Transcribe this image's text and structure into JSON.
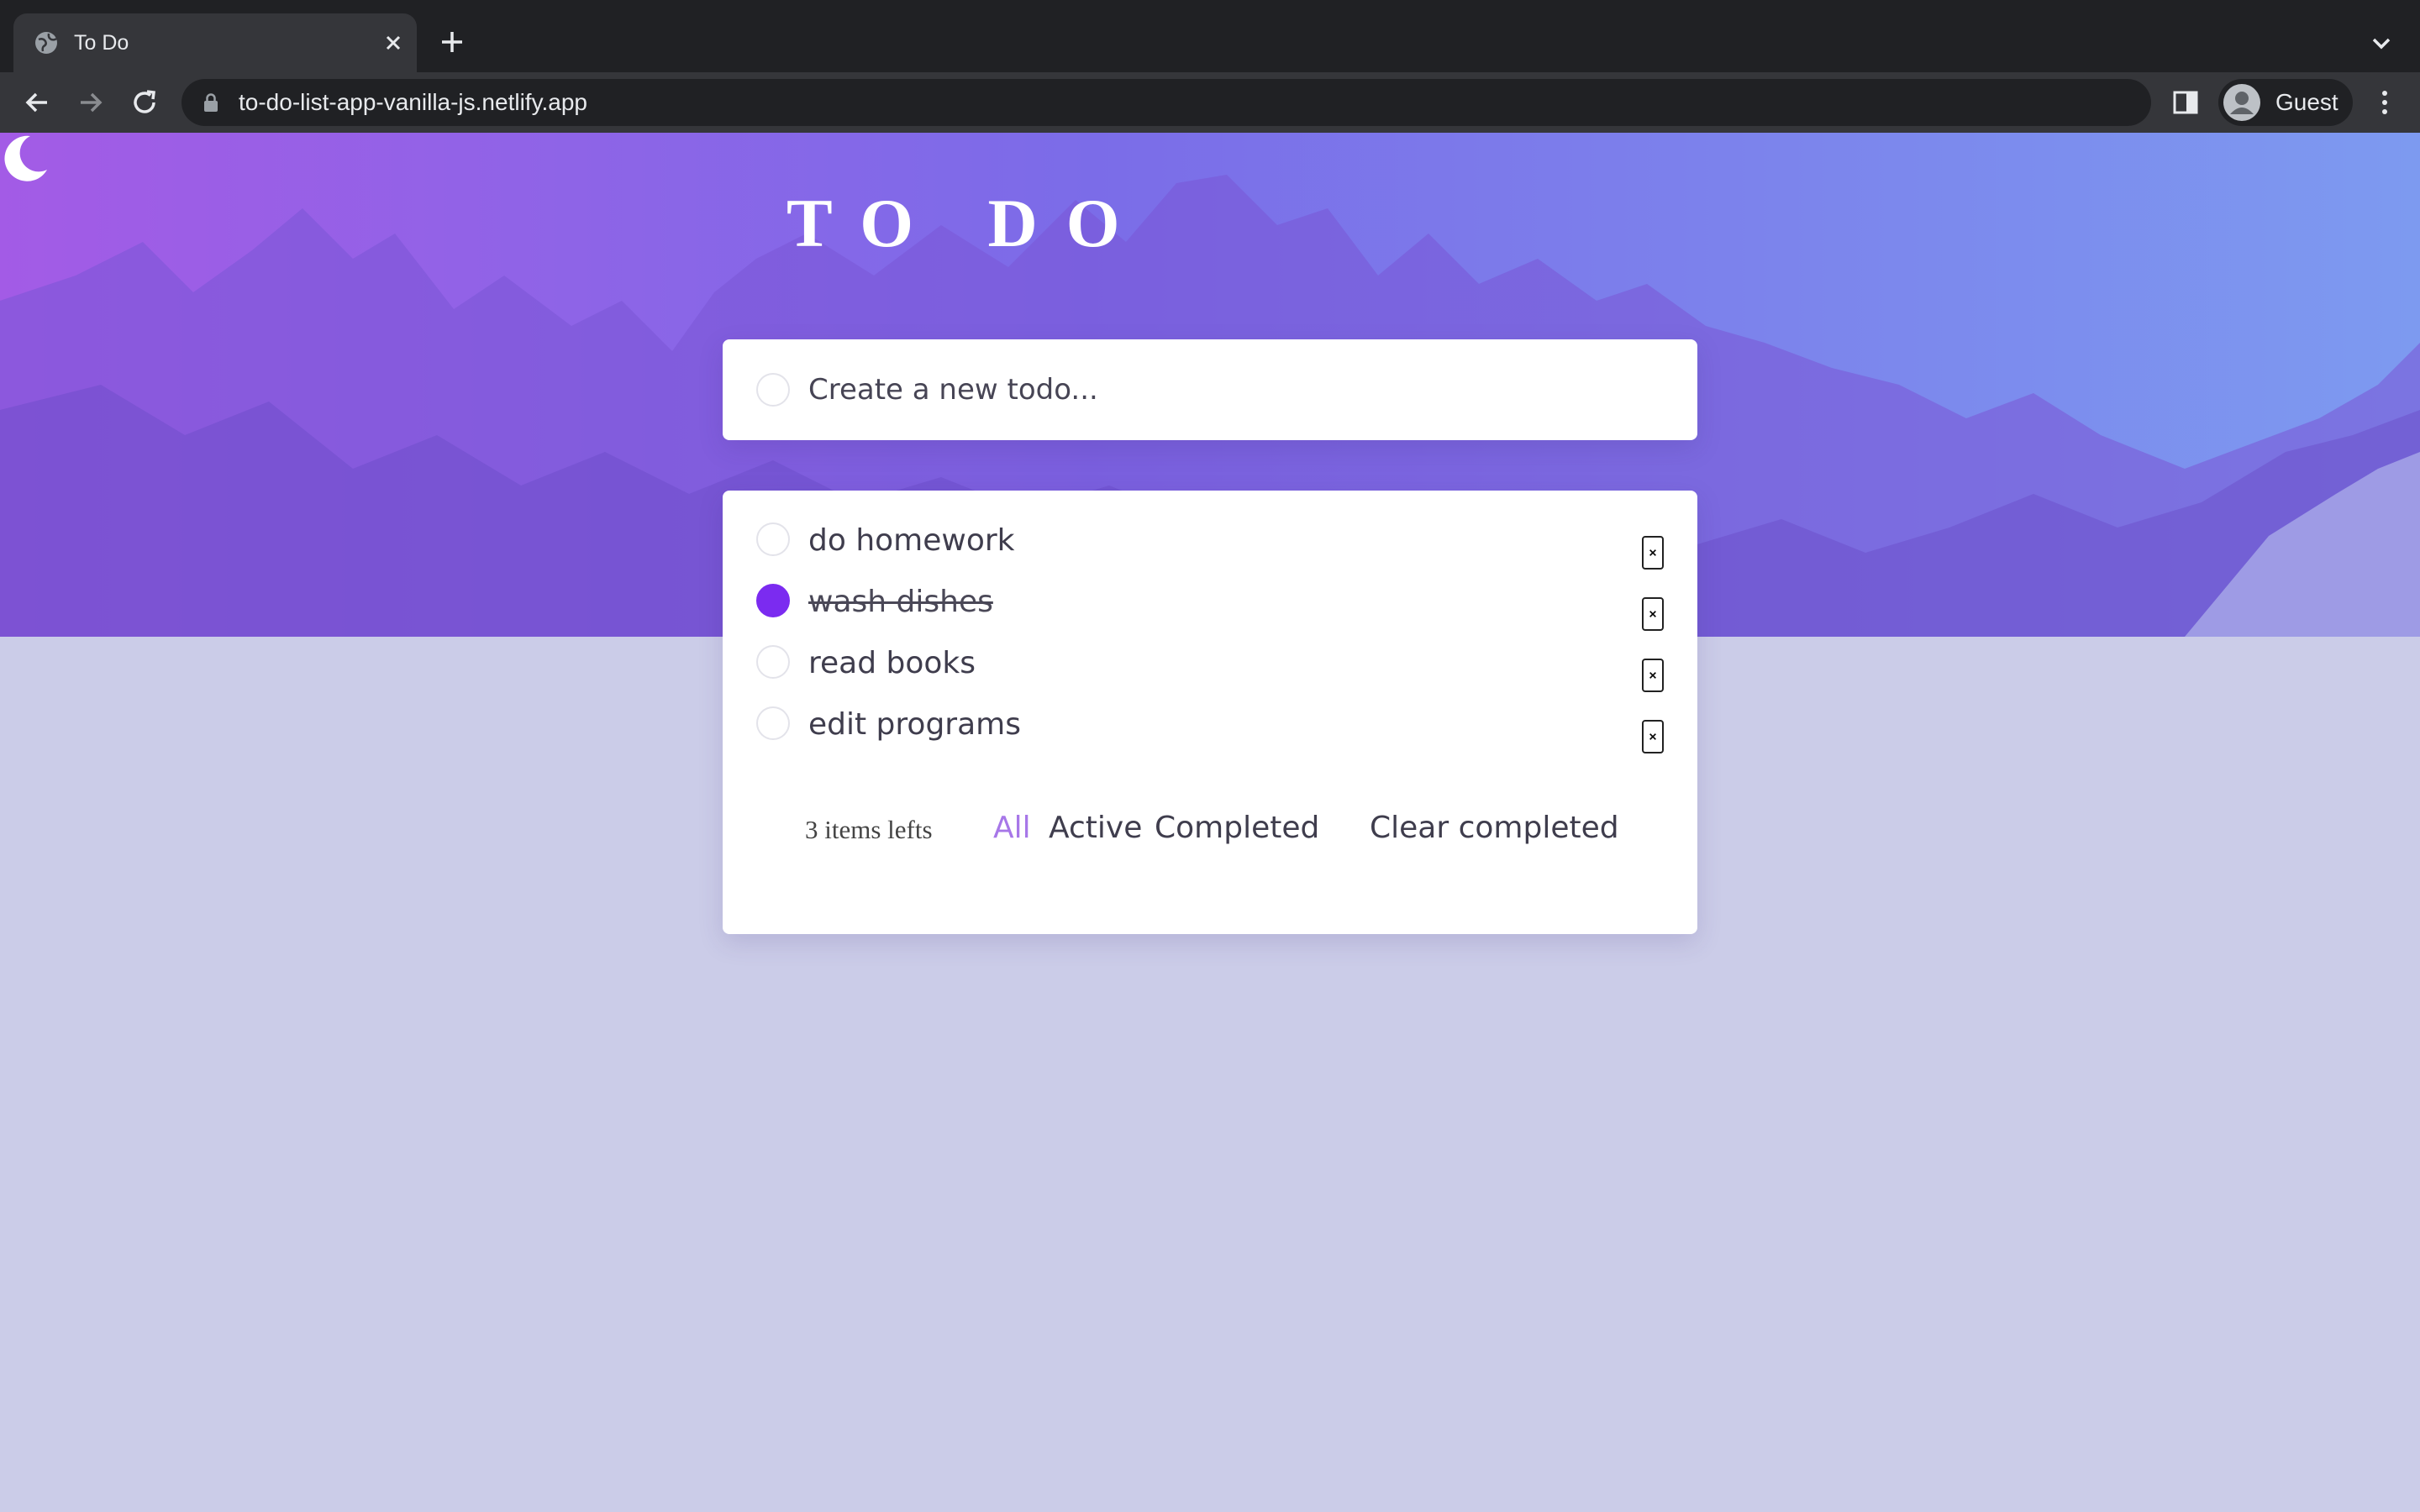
{
  "browser": {
    "tab_title": "To Do",
    "url": "to-do-list-app-vanilla-js.netlify.app",
    "profile": "Guest",
    "icons": [
      "globe-icon",
      "close-icon",
      "plus-icon",
      "chevron-down-icon",
      "back-arrow-icon",
      "forward-arrow-icon",
      "reload-icon",
      "lock-icon",
      "side-panel-icon",
      "avatar-icon",
      "kebab-menu-icon"
    ]
  },
  "app": {
    "title": "TO DO",
    "theme_icon": "moon-icon",
    "new_todo_placeholder": "Create a new todo...",
    "todos": [
      {
        "text": "do homework",
        "completed": false
      },
      {
        "text": "wash dishes",
        "completed": true
      },
      {
        "text": "read books",
        "completed": false
      },
      {
        "text": "edit programs",
        "completed": false
      }
    ],
    "items_left": "3 items lefts",
    "filters": [
      "All",
      "Active",
      "Completed"
    ],
    "active_filter": "All",
    "clear_label": "Clear completed"
  },
  "colors": {
    "accent": "#7b2bf0",
    "active_filter": "#a777e8",
    "page_background": "#cbcce8",
    "hero_gradient_left": "#a35be6",
    "hero_gradient_right": "#7d9af0"
  }
}
